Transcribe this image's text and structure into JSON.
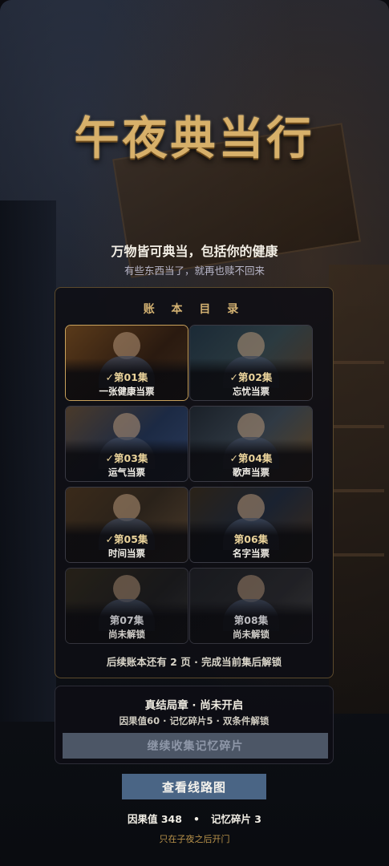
{
  "title": "午夜典当行",
  "subtitle": "万物皆可典当，包括你的健康",
  "subtitle2": "有些东西当了，就再也赎不回来",
  "ledger": {
    "title": "账 本 目 录",
    "episodes": [
      {
        "check": "✓",
        "number": "第01集",
        "name": "一张健康当票",
        "unlocked": true
      },
      {
        "check": "✓",
        "number": "第02集",
        "name": "忘忧当票",
        "unlocked": true
      },
      {
        "check": "✓",
        "number": "第03集",
        "name": "运气当票",
        "unlocked": true
      },
      {
        "check": "✓",
        "number": "第04集",
        "name": "歌声当票",
        "unlocked": true
      },
      {
        "check": "✓",
        "number": "第05集",
        "name": "时间当票",
        "unlocked": true
      },
      {
        "check": "",
        "number": "第06集",
        "name": "名字当票",
        "unlocked": true
      },
      {
        "check": "",
        "number": "第07集",
        "name": "尚未解锁",
        "unlocked": false
      },
      {
        "check": "",
        "number": "第08集",
        "name": "尚未解锁",
        "unlocked": false
      }
    ],
    "more_pages": "后续账本还有 2 页 · 完成当前集后解锁"
  },
  "finale": {
    "title": "真结局章 · 尚未开启",
    "requirement": "因果值60 · 记忆碎片5 · 双条件解锁",
    "button_label": "继续收集记忆碎片"
  },
  "route_button": "查看线路图",
  "stats": {
    "karma": "因果值 348",
    "separator": "•",
    "fragments": "记忆碎片 3"
  },
  "footer": "只在子夜之后开门",
  "colors": {
    "gold": "#d7b06a",
    "accent_button": "#4a6585",
    "disabled_button": "#4c5666"
  }
}
